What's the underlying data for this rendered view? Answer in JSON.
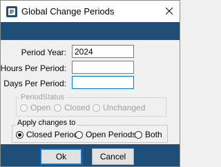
{
  "window": {
    "title": "Global Change Periods",
    "close_glyph": "✕"
  },
  "form": {
    "period_year_label": "Period Year:",
    "period_year_value": "2024",
    "hours_label": "Hours Per Period:",
    "hours_value": "",
    "days_label": "Days Per Period:",
    "days_value": ""
  },
  "period_status": {
    "title": "PeriodStatus",
    "options": [
      "Open",
      "Closed",
      "Unchanged"
    ]
  },
  "apply_changes": {
    "title": "Apply changes to",
    "options": [
      "Closed Periods",
      "Open Periods",
      "Both"
    ],
    "selected": "Closed Periods"
  },
  "buttons": {
    "ok": "Ok",
    "cancel": "Cancel"
  },
  "colors": {
    "band": "#1f4e79",
    "focus": "#0078d7"
  }
}
